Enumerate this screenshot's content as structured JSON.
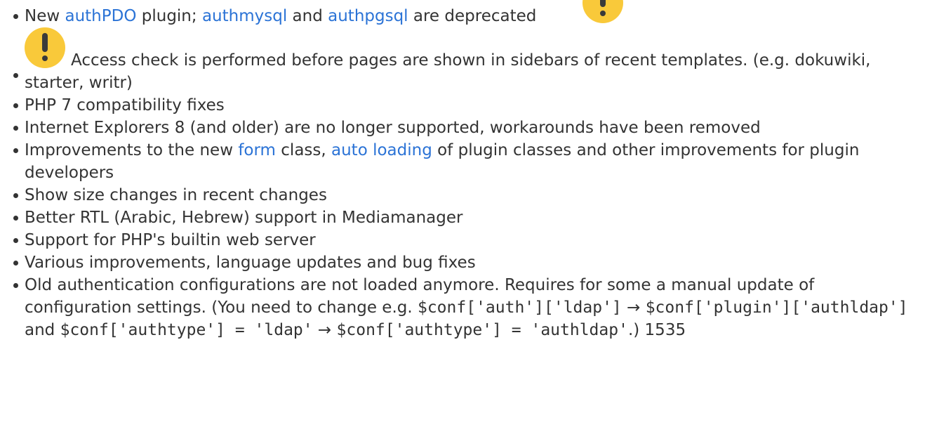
{
  "items": {
    "authpdo": {
      "pre": "New ",
      "link1": "authPDO",
      "mid1": " plugin; ",
      "link2": "authmysql",
      "mid2": " and ",
      "link3": "authpgsql",
      "post": " are deprecated"
    },
    "access_check": {
      "text": "Access check is performed before pages are shown in sidebars of recent templates. (e.g. dokuwiki, starter, writr)"
    },
    "php7": "PHP 7 compatibility fixes",
    "ie8": "Internet Explorers 8 (and older) are no longer supported, workarounds have been removed",
    "form": {
      "pre": "Improvements to the new ",
      "link1": "form",
      "mid": " class, ",
      "link2": "auto loading",
      "post": " of plugin classes and other improvements for plugin developers"
    },
    "size_changes": "Show size changes in recent changes",
    "rtl": "Better RTL (Arabic, Hebrew) support in Mediamanager",
    "builtin_server": "Support for PHP's builtin web server",
    "various": "Various improvements, language updates and bug fixes",
    "auth_config": {
      "t1": "Old authentication configurations are not loaded anymore. Requires for some a manual update of configuration settings. (You need to change e.g. ",
      "c1": "$conf['auth']['ldap']",
      "t2": " → ",
      "c2": "$conf['plugin']['authldap']",
      "t3": " and ",
      "c3": "$conf['authtype'] = 'ldap'",
      "t4": " → ",
      "c4": "$conf['authtype'] = 'authldap'",
      "t5": ".) 1535"
    }
  },
  "icons": {
    "warning": "warning-icon",
    "warning_color": "#f9c93a",
    "link_color": "#2b73d6"
  }
}
